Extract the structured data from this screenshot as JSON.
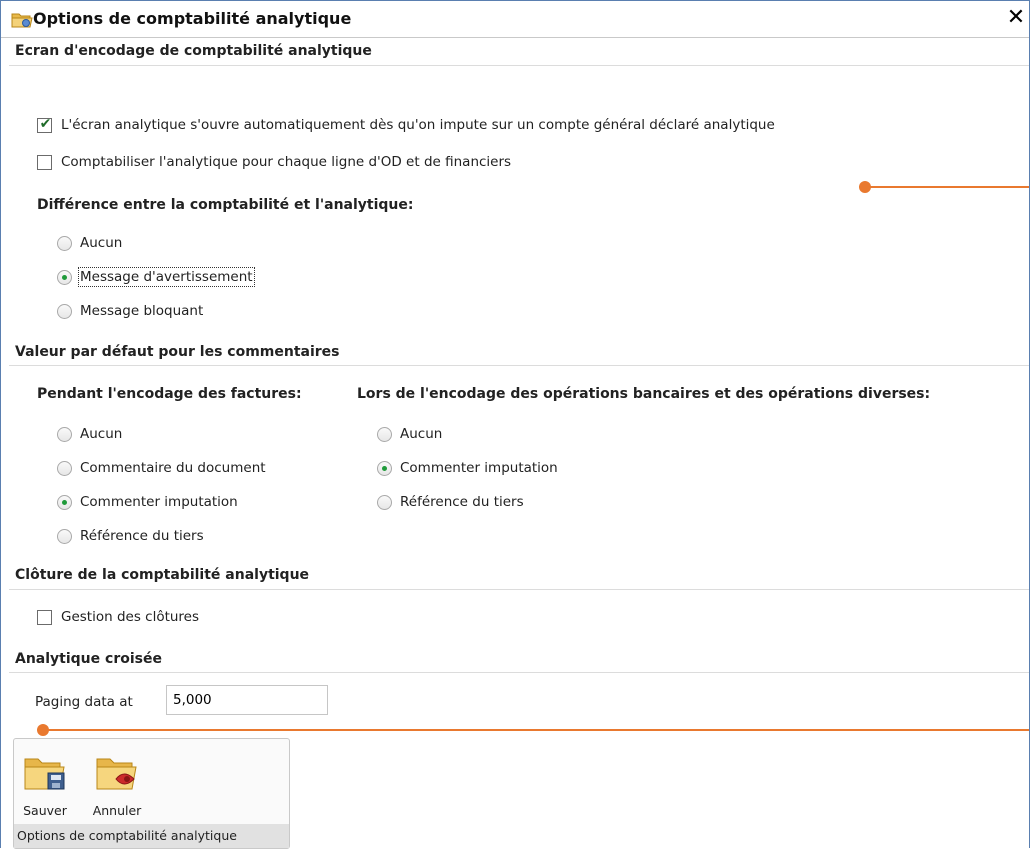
{
  "window": {
    "title": "Options de comptabilité analytique",
    "close_label": "✕"
  },
  "sections": {
    "encodage": {
      "header": "Ecran d'encodage de comptabilité analytique",
      "checkbox_auto": {
        "label": "L'écran analytique s'ouvre automatiquement dès qu'on impute sur un compte général déclaré analytique",
        "checked": true
      },
      "checkbox_od": {
        "label": "Comptabiliser l'analytique pour chaque ligne d'OD et de financiers",
        "checked": false
      },
      "difference": {
        "header": "Différence entre la comptabilité et l'analytique:",
        "options": [
          "Aucun",
          "Message d'avertissement",
          "Message bloquant"
        ],
        "selected": "Message d'avertissement"
      }
    },
    "commentaires": {
      "header": "Valeur par défaut pour les commentaires",
      "factures": {
        "header": "Pendant l'encodage des factures:",
        "options": [
          "Aucun",
          "Commentaire du document",
          "Commenter imputation",
          "Référence du tiers"
        ],
        "selected": "Commenter imputation"
      },
      "bancaires": {
        "header": "Lors de l'encodage des opérations bancaires et des opérations diverses:",
        "options": [
          "Aucun",
          "Commenter imputation",
          "Référence du tiers"
        ],
        "selected": "Commenter imputation"
      }
    },
    "cloture": {
      "header": "Clôture de la comptabilité analytique",
      "checkbox": {
        "label": "Gestion des clôtures",
        "checked": false
      }
    },
    "croisee": {
      "header": "Analytique croisée",
      "paging_label": "Paging data at",
      "paging_value": "5,000"
    }
  },
  "ribbon": {
    "save_label": "Sauver",
    "cancel_label": "Annuler",
    "group_label": "Options de comptabilité analytique"
  },
  "colors": {
    "accent_connector": "#e9792f",
    "radio_selected": "#1f9a3a",
    "check_mark": "#1f6b2a",
    "window_border": "#5a7fb0"
  },
  "icons": {
    "title": "folder-options-icon",
    "save": "folder-save-icon",
    "cancel": "folder-cancel-icon",
    "close": "close-icon"
  }
}
